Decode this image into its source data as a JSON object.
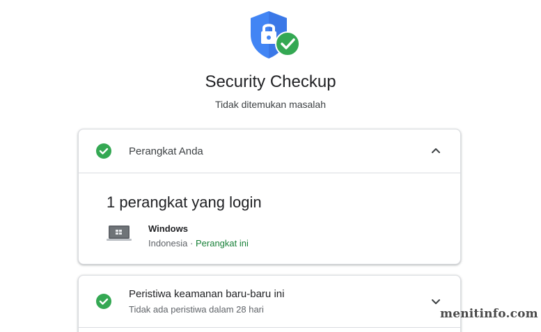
{
  "header": {
    "icon": "shield-lock-check-icon",
    "title": "Security Checkup",
    "subtitle": "Tidak ditemukan masalah"
  },
  "cards": {
    "devices": {
      "icon": "check-circle-icon",
      "title": "Perangkat Anda",
      "expanded": true,
      "chevron": "chevron-up-icon",
      "heading": "1 perangkat yang login",
      "device": {
        "icon": "laptop-icon",
        "name": "Windows",
        "location": "Indonesia",
        "separator": "·",
        "this_device": "Perangkat ini"
      }
    },
    "events": {
      "icon": "check-circle-icon",
      "title": "Peristiwa keamanan baru-baru ini",
      "subtitle": "Tidak ada peristiwa dalam 28 hari",
      "expanded": false,
      "chevron": "chevron-down-icon"
    }
  },
  "watermark": "menitinfo.com",
  "colors": {
    "success_green": "#34a853",
    "shield_blue": "#4285f4",
    "link_green": "#188038",
    "text_primary": "#202124",
    "text_secondary": "#5f6368",
    "border": "#dadce0"
  }
}
